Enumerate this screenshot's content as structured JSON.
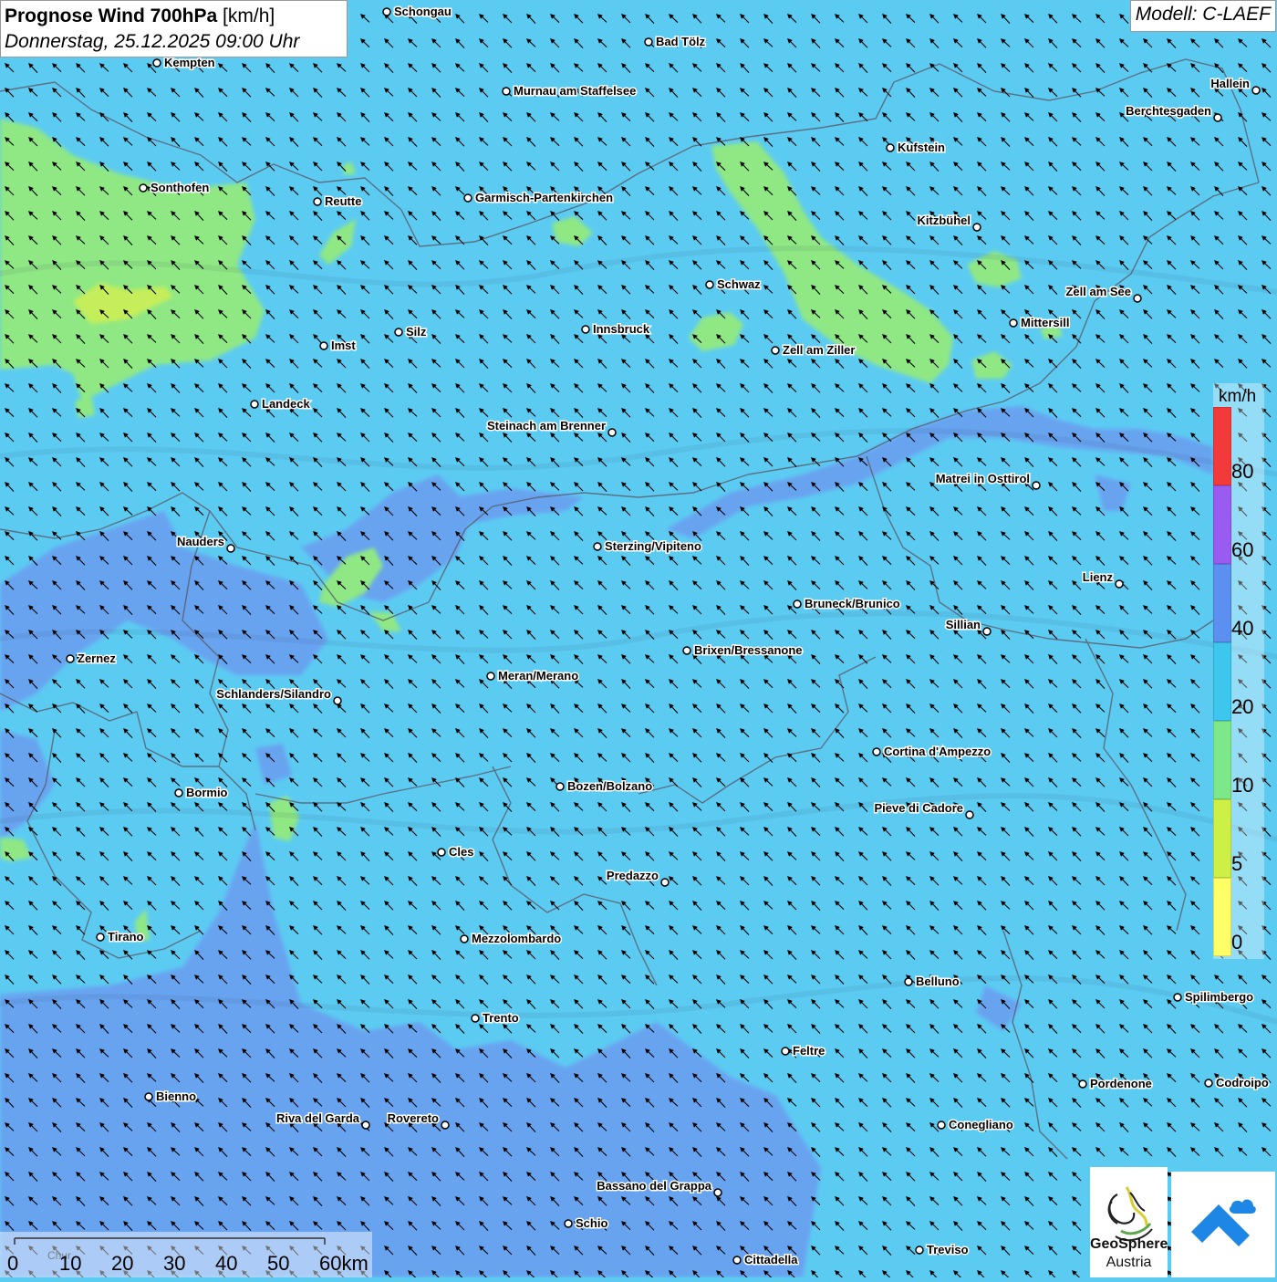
{
  "header": {
    "title_bold": "Prognose Wind 700hPa",
    "title_unit": "[km/h]",
    "datetime": "Donnerstag, 25.12.2025 09:00 Uhr"
  },
  "model_label": "Modell: C-LAEF",
  "legend": {
    "unit": "km/h",
    "bins": [
      {
        "label": "0",
        "color": "#ffff66"
      },
      {
        "label": "5",
        "color": "#cdf046"
      },
      {
        "label": "10",
        "color": "#7de88a"
      },
      {
        "label": "20",
        "color": "#3dc6ee"
      },
      {
        "label": "40",
        "color": "#5b8ff0"
      },
      {
        "label": "60",
        "color": "#9a5cf0"
      },
      {
        "label": "80",
        "color": "#f23a3a"
      }
    ]
  },
  "scale_bar": {
    "labels": [
      "0",
      "10",
      "20",
      "30",
      "40",
      "50",
      "60km"
    ],
    "small_label": "Chur"
  },
  "branding": {
    "org_line1": "GeoSphere",
    "org_line2": "Austria"
  },
  "cities": [
    {
      "name": "Schongau",
      "label_side": "right"
    },
    {
      "name": "Bad Tölz",
      "label_side": "right"
    },
    {
      "name": "Kempten",
      "label_side": "right"
    },
    {
      "name": "Murnau am Staffelsee",
      "label_side": "right"
    },
    {
      "name": "Hallein",
      "label_side": "left"
    },
    {
      "name": "Berchtesgaden",
      "label_side": "left"
    },
    {
      "name": "Kufstein",
      "label_side": "right"
    },
    {
      "name": "Sonthofen",
      "label_side": "right"
    },
    {
      "name": "Reutte",
      "label_side": "right"
    },
    {
      "name": "Garmisch-Partenkirchen",
      "label_side": "right"
    },
    {
      "name": "Kitzbühel",
      "label_side": "left"
    },
    {
      "name": "Schwaz",
      "label_side": "right"
    },
    {
      "name": "Zell am See",
      "label_side": "left"
    },
    {
      "name": "Innsbruck",
      "label_side": "right"
    },
    {
      "name": "Silz",
      "label_side": "right"
    },
    {
      "name": "Mittersill",
      "label_side": "right"
    },
    {
      "name": "Imst",
      "label_side": "right"
    },
    {
      "name": "Zell am Ziller",
      "label_side": "right"
    },
    {
      "name": "Landeck",
      "label_side": "right"
    },
    {
      "name": "Steinach am Brenner",
      "label_side": "left"
    },
    {
      "name": "Matrei in Osttirol",
      "label_side": "left"
    },
    {
      "name": "Nauders",
      "label_side": "left"
    },
    {
      "name": "Sterzing/Vipiteno",
      "label_side": "right"
    },
    {
      "name": "Lienz",
      "label_side": "left"
    },
    {
      "name": "Bruneck/Brunico",
      "label_side": "right"
    },
    {
      "name": "Sillian",
      "label_side": "left"
    },
    {
      "name": "Brixen/Bressanone",
      "label_side": "right"
    },
    {
      "name": "Zernez",
      "label_side": "right"
    },
    {
      "name": "Meran/Merano",
      "label_side": "right"
    },
    {
      "name": "Schlanders/Silandro",
      "label_side": "left"
    },
    {
      "name": "Cortina d'Ampezzo",
      "label_side": "right"
    },
    {
      "name": "Bozen/Bolzano",
      "label_side": "right"
    },
    {
      "name": "Bormio",
      "label_side": "right"
    },
    {
      "name": "Pieve di Cadore",
      "label_side": "left"
    },
    {
      "name": "Cles",
      "label_side": "right"
    },
    {
      "name": "Predazzo",
      "label_side": "left"
    },
    {
      "name": "Tirano",
      "label_side": "right"
    },
    {
      "name": "Mezzolombardo",
      "label_side": "right"
    },
    {
      "name": "Belluno",
      "label_side": "right"
    },
    {
      "name": "Spilimbergo",
      "label_side": "right"
    },
    {
      "name": "Trento",
      "label_side": "right"
    },
    {
      "name": "Feltre",
      "label_side": "right"
    },
    {
      "name": "Pordenone",
      "label_side": "right"
    },
    {
      "name": "Codroipo",
      "label_side": "right"
    },
    {
      "name": "Bienno",
      "label_side": "right"
    },
    {
      "name": "Riva del Garda",
      "label_side": "left"
    },
    {
      "name": "Rovereto",
      "label_side": "left"
    },
    {
      "name": "Conegliano",
      "label_side": "right"
    },
    {
      "name": "Bassano del Grappa",
      "label_side": "left"
    },
    {
      "name": "Schio",
      "label_side": "right"
    },
    {
      "name": "Treviso",
      "label_side": "right"
    },
    {
      "name": "Cittadella",
      "label_side": "right"
    }
  ],
  "wind": {
    "direction": "from southeast",
    "arrow_heading": "northwest"
  }
}
